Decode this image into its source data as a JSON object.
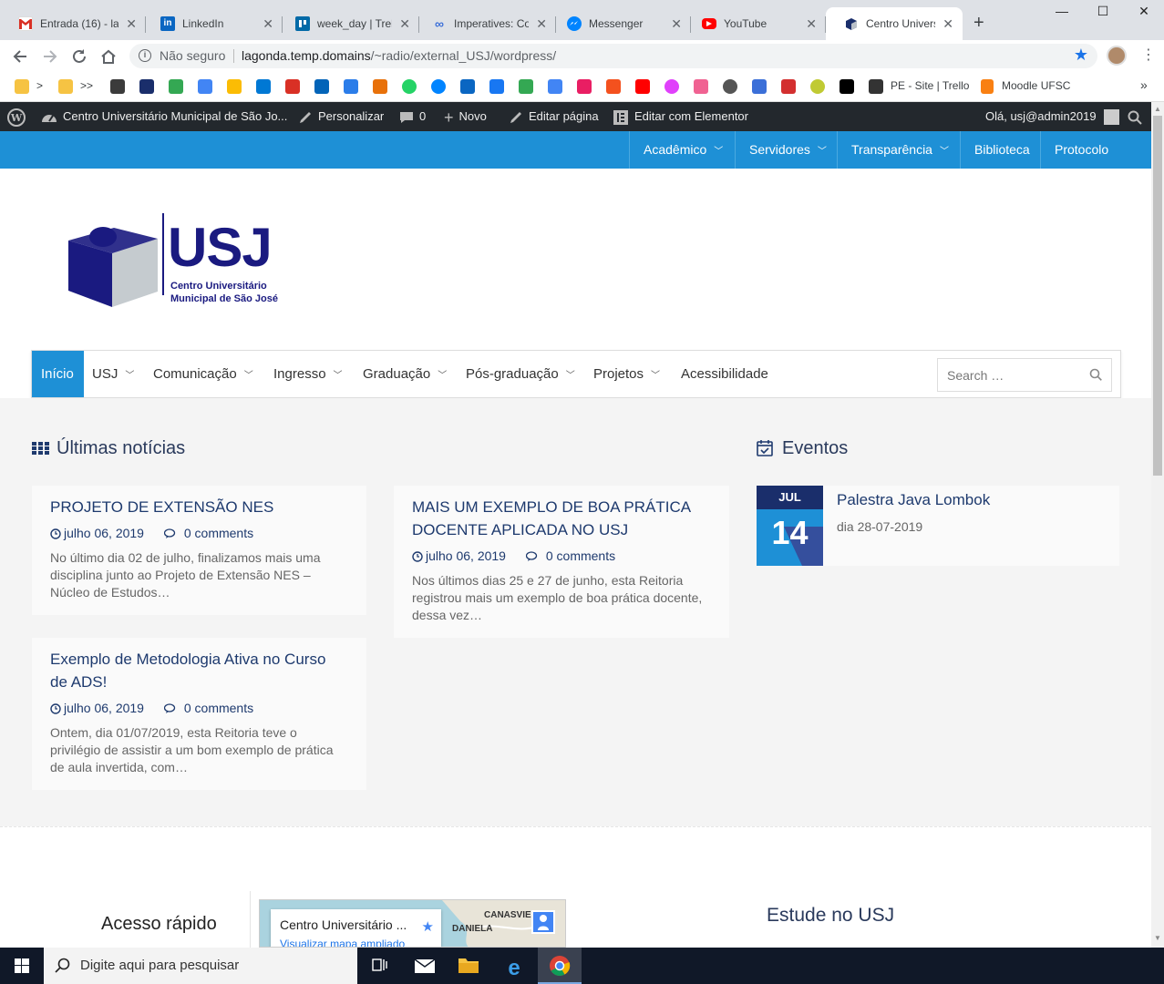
{
  "browser": {
    "tabs": [
      {
        "title": "Entrada (16) - la",
        "icon": "gmail-icon",
        "color": "#d93025",
        "badge": "16"
      },
      {
        "title": "LinkedIn",
        "icon": "linkedin-icon",
        "color": "#0a66c2"
      },
      {
        "title": "week_day | Trello",
        "icon": "trello-icon",
        "color": "#026aa7"
      },
      {
        "title": "Imperatives: Cor",
        "icon": "link-icon",
        "color": "#3b6fd8"
      },
      {
        "title": "Messenger",
        "icon": "messenger-icon",
        "color": "#0084ff"
      },
      {
        "title": "YouTube",
        "icon": "youtube-icon",
        "color": "#ff0000"
      },
      {
        "title": "Centro Universit",
        "icon": "usj-icon",
        "color": "#1a2e6b"
      }
    ],
    "new_tab_symbol": "+",
    "omnibox": {
      "security": "Não seguro",
      "url_host": "lagonda.temp.domains",
      "url_path": "/~radio/external_USJ/wordpress/"
    },
    "bookmarks": {
      "chevron_left": ">",
      "chevron_more": ">>",
      "items": [
        {
          "label": "PE - Site | Trello",
          "icon": "trello-icon"
        },
        {
          "label": "Moodle UFSC",
          "icon": "moodle-icon"
        }
      ],
      "overflow": "»"
    }
  },
  "adminbar": {
    "site_name": "Centro Universitário Municipal de São Jo...",
    "customize": "Personalizar",
    "comments_count": "0",
    "new": "Novo",
    "edit_page": "Editar página",
    "edit_elementor": "Editar com Elementor",
    "greeting": "Olá, usj@admin2019"
  },
  "topnav": [
    {
      "label": "Acadêmico",
      "has_dropdown": true
    },
    {
      "label": "Servidores",
      "has_dropdown": true
    },
    {
      "label": "Transparência",
      "has_dropdown": true
    },
    {
      "label": "Biblioteca",
      "has_dropdown": false
    },
    {
      "label": "Protocolo",
      "has_dropdown": false
    }
  ],
  "logo": {
    "acronym": "USJ",
    "line1": "Centro Universitário",
    "line2": "Municipal de São José"
  },
  "mainmenu": {
    "items": [
      {
        "label": "Início",
        "has_dropdown": false,
        "active": true
      },
      {
        "label": "USJ",
        "has_dropdown": true
      },
      {
        "label": "Comunicação",
        "has_dropdown": true
      },
      {
        "label": "Ingresso",
        "has_dropdown": true
      },
      {
        "label": "Graduação",
        "has_dropdown": true
      },
      {
        "label": "Pós-graduação",
        "has_dropdown": true
      },
      {
        "label": "Projetos",
        "has_dropdown": true
      },
      {
        "label": "Acessibilidade",
        "has_dropdown": false
      }
    ],
    "search_placeholder": "Search …"
  },
  "news": {
    "title": "Últimas notícias",
    "posts": [
      {
        "title_lines": [
          "PROJETO DE EXTENSÃO NES"
        ],
        "date": "julho 06, 2019",
        "comments": "0 comments",
        "excerpt_lines": [
          "No último dia 02 de julho, finalizamos mais uma",
          "disciplina junto ao Projeto de Extensão NES –",
          "Núcleo de Estudos…"
        ]
      },
      {
        "title_lines": [
          "MAIS UM EXEMPLO DE BOA PRÁTICA",
          "DOCENTE APLICADA NO USJ"
        ],
        "date": "julho 06, 2019",
        "comments": "0 comments",
        "excerpt_lines": [
          "Nos últimos dias 25 e 27 de junho, esta Reitoria",
          "registrou mais um exemplo de boa prática docente,",
          "dessa vez…"
        ]
      },
      {
        "title_lines": [
          "Exemplo de Metodologia Ativa no Curso",
          "de ADS!"
        ],
        "date": "julho 06, 2019",
        "comments": "0 comments",
        "excerpt_lines": [
          "Ontem, dia 01/07/2019, esta Reitoria teve o",
          "privilégio de assistir a um bom exemplo de prática",
          "de aula invertida, com…"
        ]
      }
    ]
  },
  "events": {
    "title": "Eventos",
    "items": [
      {
        "month": "JUL",
        "day": "14",
        "title": "Palestra Java Lombok",
        "subtitle": "dia 28-07-2019"
      }
    ]
  },
  "footer": {
    "quick_access": "Acesso rápido",
    "map": {
      "place": "Centro Universitário ...",
      "link": "Visualizar mapa ampliado",
      "labels": [
        "CANASVIE",
        "DANIELA"
      ]
    },
    "study": "Estude no USJ"
  },
  "taskbar": {
    "search_placeholder": "Digite aqui para pesquisar"
  },
  "colors": {
    "brand_blue": "#1e90d6",
    "brand_navy": "#1a2e6b",
    "admin_bar": "#23282d"
  }
}
